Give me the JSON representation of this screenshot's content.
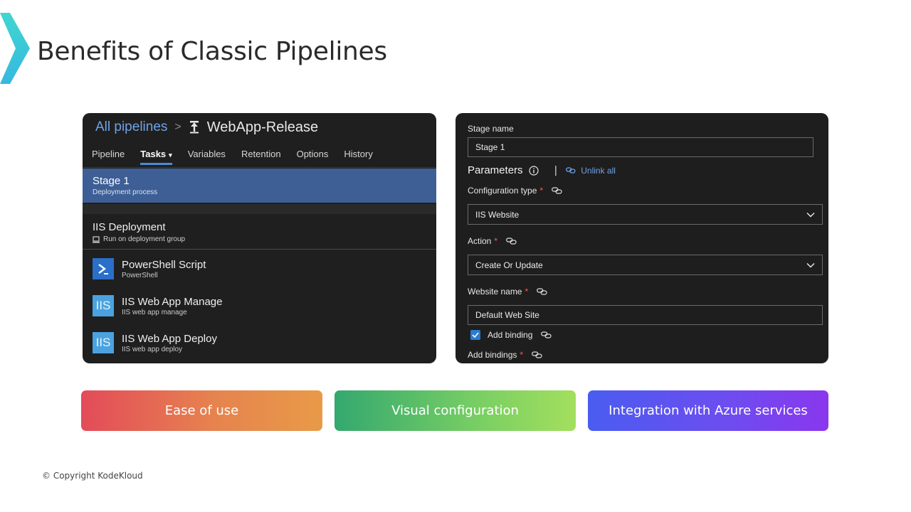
{
  "slide": {
    "title": "Benefits of Classic Pipelines",
    "copyright": "© Copyright KodeKloud",
    "accent_color": "#35d0d6"
  },
  "left_panel": {
    "breadcrumb": {
      "root": "All pipelines",
      "separator": ">",
      "pipeline_name": "WebApp-Release",
      "pipeline_icon": "pipeline-release-icon"
    },
    "tabs": [
      {
        "label": "Pipeline",
        "active": false
      },
      {
        "label": "Tasks",
        "active": true
      },
      {
        "label": "Variables",
        "active": false
      },
      {
        "label": "Retention",
        "active": false
      },
      {
        "label": "Options",
        "active": false
      },
      {
        "label": "History",
        "active": false
      }
    ],
    "stage": {
      "title": "Stage 1",
      "subtitle": "Deployment process"
    },
    "job": {
      "title": "IIS Deployment",
      "subtitle": "Run on deployment group"
    },
    "tasks": [
      {
        "name": "PowerShell Script",
        "sub": "PowerShell",
        "icon": "powershell-icon"
      },
      {
        "name": "IIS Web App Manage",
        "sub": "IIS web app manage",
        "icon": "iis-icon",
        "icon_text": "IIS"
      },
      {
        "name": "IIS Web App Deploy",
        "sub": "IIS web app deploy",
        "icon": "iis-icon",
        "icon_text": "IIS"
      }
    ]
  },
  "right_panel": {
    "stage_name_label": "Stage name",
    "stage_name_value": "Stage 1",
    "parameters_title": "Parameters",
    "unlink_all": "Unlink all",
    "separator": "|",
    "config_type_label": "Configuration type",
    "config_type_value": "IIS Website",
    "action_label": "Action",
    "action_value": "Create Or Update",
    "website_name_label": "Website name",
    "website_name_value": "Default Web Site",
    "add_binding_label": "Add binding",
    "add_binding_checked": true,
    "add_bindings_label": "Add bindings",
    "required_mark": "*"
  },
  "benefits": [
    {
      "label": "Ease of use"
    },
    {
      "label": "Visual configuration"
    },
    {
      "label": "Integration with Azure services"
    }
  ]
}
